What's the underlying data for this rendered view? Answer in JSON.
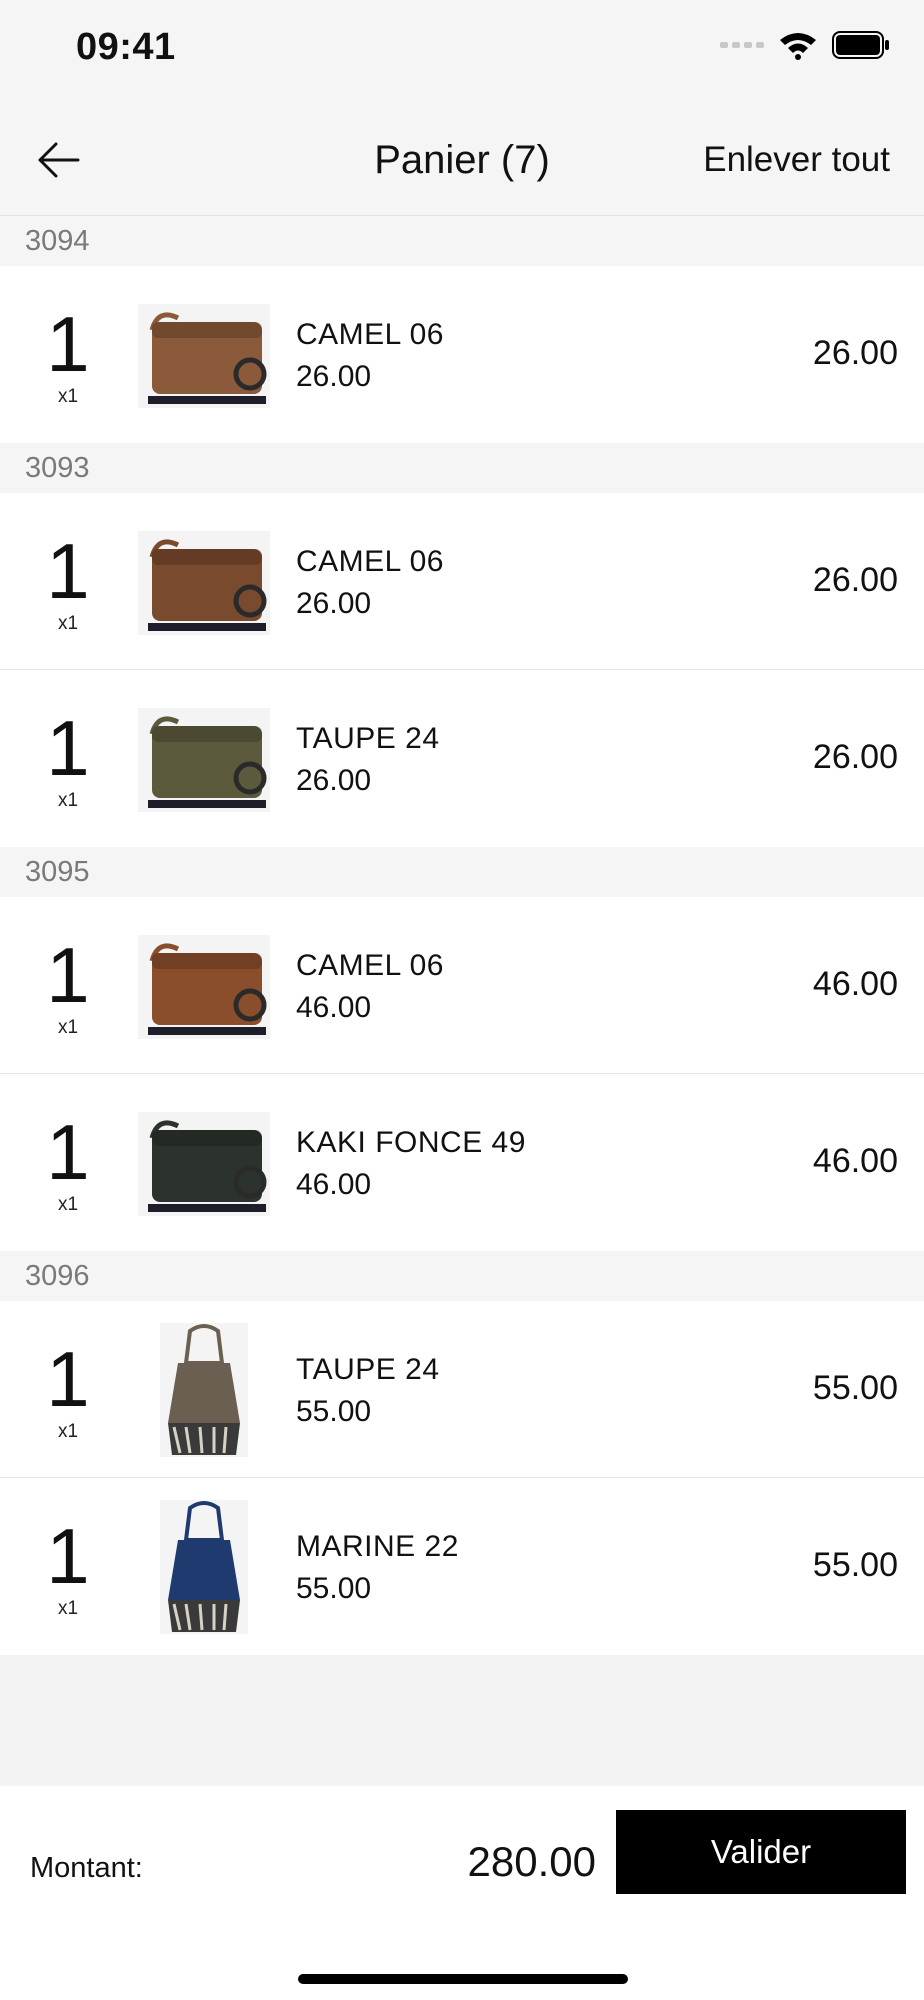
{
  "status_bar": {
    "time": "09:41"
  },
  "header": {
    "title": "Panier (7)",
    "clear_label": "Enlever tout",
    "back_icon": "arrow-left-icon"
  },
  "groups": [
    {
      "id": "3094",
      "items": [
        {
          "qty": "1",
          "mult": "x1",
          "name": "CAMEL 06",
          "unit_price": "26.00",
          "total": "26.00",
          "color": "#8a5a3a"
        }
      ]
    },
    {
      "id": "3093",
      "items": [
        {
          "qty": "1",
          "mult": "x1",
          "name": "CAMEL 06",
          "unit_price": "26.00",
          "total": "26.00",
          "color": "#7a4a2e"
        },
        {
          "qty": "1",
          "mult": "x1",
          "name": "TAUPE 24",
          "unit_price": "26.00",
          "total": "26.00",
          "color": "#5c5a3c"
        }
      ]
    },
    {
      "id": "3095",
      "items": [
        {
          "qty": "1",
          "mult": "x1",
          "name": "CAMEL 06",
          "unit_price": "46.00",
          "total": "46.00",
          "color": "#8a4e2c"
        },
        {
          "qty": "1",
          "mult": "x1",
          "name": "KAKI FONCE 49",
          "unit_price": "46.00",
          "total": "46.00",
          "color": "#2c332c"
        }
      ]
    },
    {
      "id": "3096",
      "items": [
        {
          "qty": "1",
          "mult": "x1",
          "name": "TAUPE 24",
          "unit_price": "55.00",
          "total": "55.00",
          "color": "#6b5f52"
        },
        {
          "qty": "1",
          "mult": "x1",
          "name": "MARINE 22",
          "unit_price": "55.00",
          "total": "55.00",
          "color": "#1f3a6e"
        }
      ]
    }
  ],
  "footer": {
    "amount_label": "Montant:",
    "amount_value": "280.00",
    "validate_label": "Valider"
  }
}
